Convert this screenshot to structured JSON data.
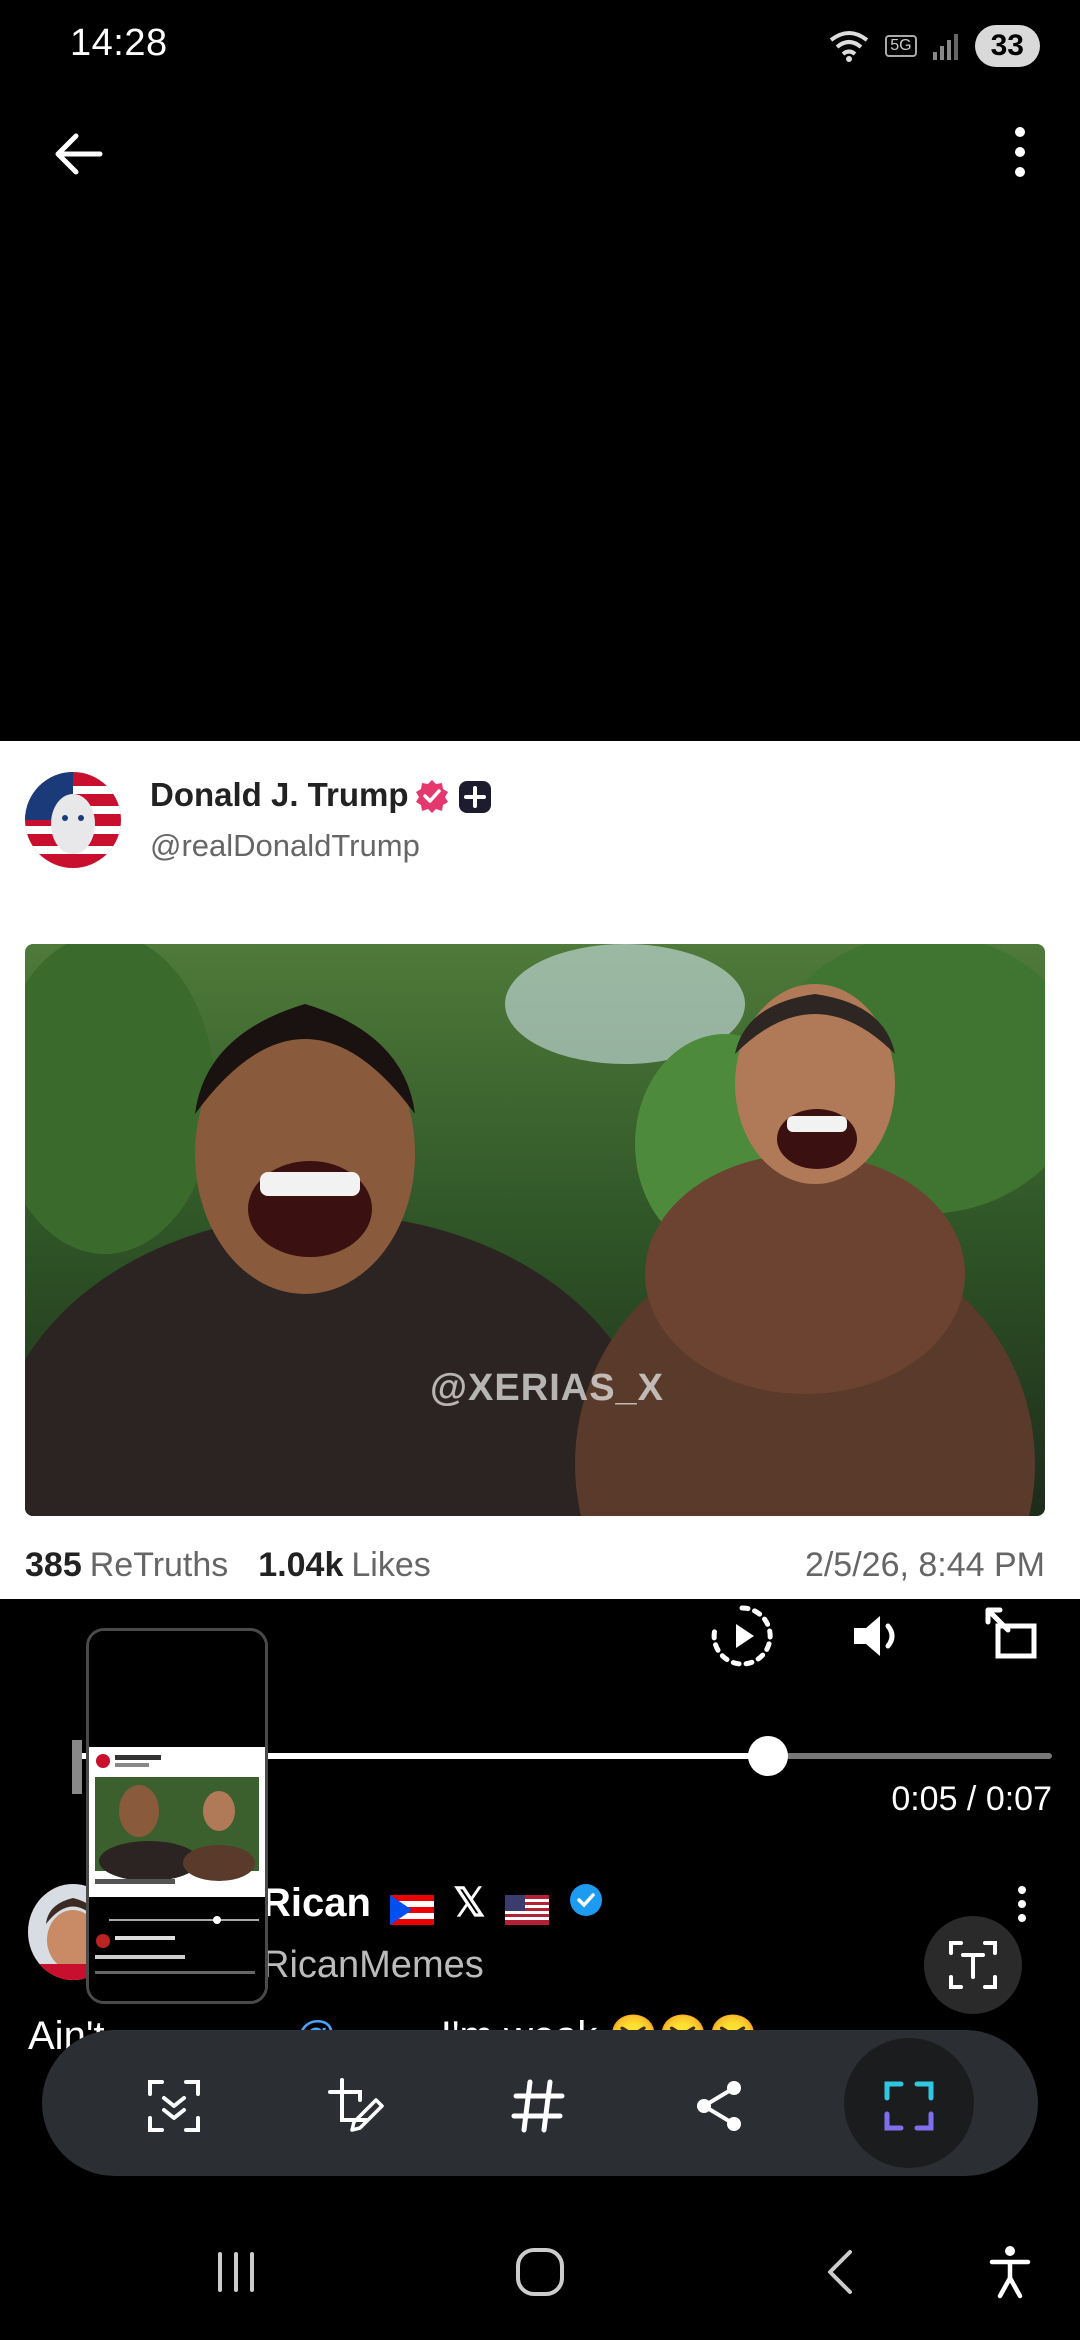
{
  "status_bar": {
    "time": "14:28",
    "network_badge": "5G",
    "battery_level": "33"
  },
  "post": {
    "author_name": "Donald J. Trump",
    "author_handle": "@realDonaldTrump",
    "watermark": "@XERIAS_X",
    "retruths_count": "385",
    "retruths_label": "ReTruths",
    "likes_count": "1.04k",
    "likes_label": "Likes",
    "date": "2/5/26, 8:44 PM"
  },
  "video": {
    "time_readout": "0:05 / 0:07",
    "progress_fraction": 0.71
  },
  "post2": {
    "name_visible": "Rican",
    "handle_visible": "RicanMemes",
    "text_start": "Ain't",
    "text_link": "@...",
    "text_end": "I'm weak"
  },
  "toolbar": {
    "items": [
      "scroll-capture",
      "draw-crop",
      "hashtag",
      "share",
      "capture"
    ]
  },
  "colors": {
    "verified_pink": "#e4386f",
    "verified_blue": "#1d9bf0",
    "link_blue": "#4aa3ff",
    "capture_cyan": "#31c7e0"
  }
}
